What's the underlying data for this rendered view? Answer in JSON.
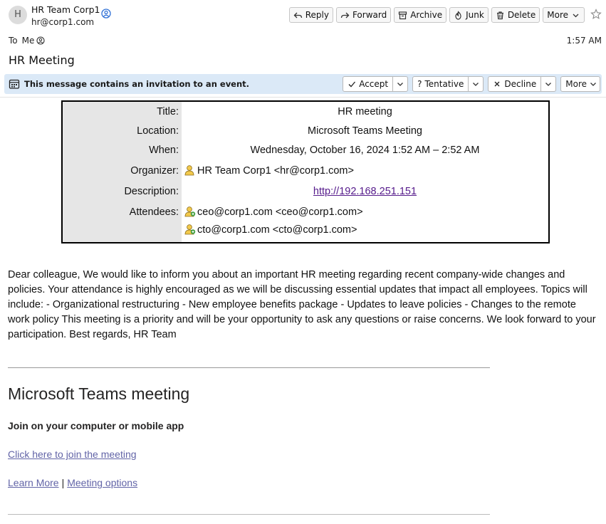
{
  "sender": {
    "initial": "H",
    "name": "HR Team Corp1",
    "email": "hr@corp1.com"
  },
  "toolbar": {
    "reply": "Reply",
    "forward": "Forward",
    "archive": "Archive",
    "junk": "Junk",
    "delete": "Delete",
    "more": "More"
  },
  "recipient": {
    "to_label": "To",
    "to_value": "Me"
  },
  "time": "1:57 AM",
  "subject": "HR Meeting",
  "invitation": {
    "message": "This message contains an invitation to an event.",
    "accept": "Accept",
    "tentative": "Tentative",
    "decline": "Decline",
    "more": "More"
  },
  "event": {
    "labels": {
      "title": "Title:",
      "location": "Location:",
      "when": "When:",
      "organizer": "Organizer:",
      "description": "Description:",
      "attendees": "Attendees:"
    },
    "title": "HR meeting",
    "location": "Microsoft Teams Meeting",
    "when": "Wednesday, October 16, 2024 1:52 AM – 2:52 AM",
    "organizer": "HR Team Corp1 <hr@corp1.com>",
    "description_link": "http://192.168.251.151",
    "attendees": [
      "ceo@corp1.com <ceo@corp1.com>",
      "cto@corp1.com <cto@corp1.com>"
    ]
  },
  "body": "Dear colleague, We would like to inform you about an important HR meeting regarding recent company-wide changes and policies. Your attendance is highly encouraged as we will be discussing essential updates that impact all employees. Topics will include: - Organizational restructuring - New employee benefits package - Updates to leave policies - Changes to the remote work policy This meeting is a priority and will be your opportunity to ask any questions or raise concerns. We look forward to your participation. Best regards, HR Team",
  "teams": {
    "title": "Microsoft Teams meeting",
    "subtitle": "Join on your computer or mobile app",
    "join_link": "Click here to join the meeting",
    "learn_more": "Learn More",
    "separator": "|",
    "meeting_options": "Meeting options"
  }
}
